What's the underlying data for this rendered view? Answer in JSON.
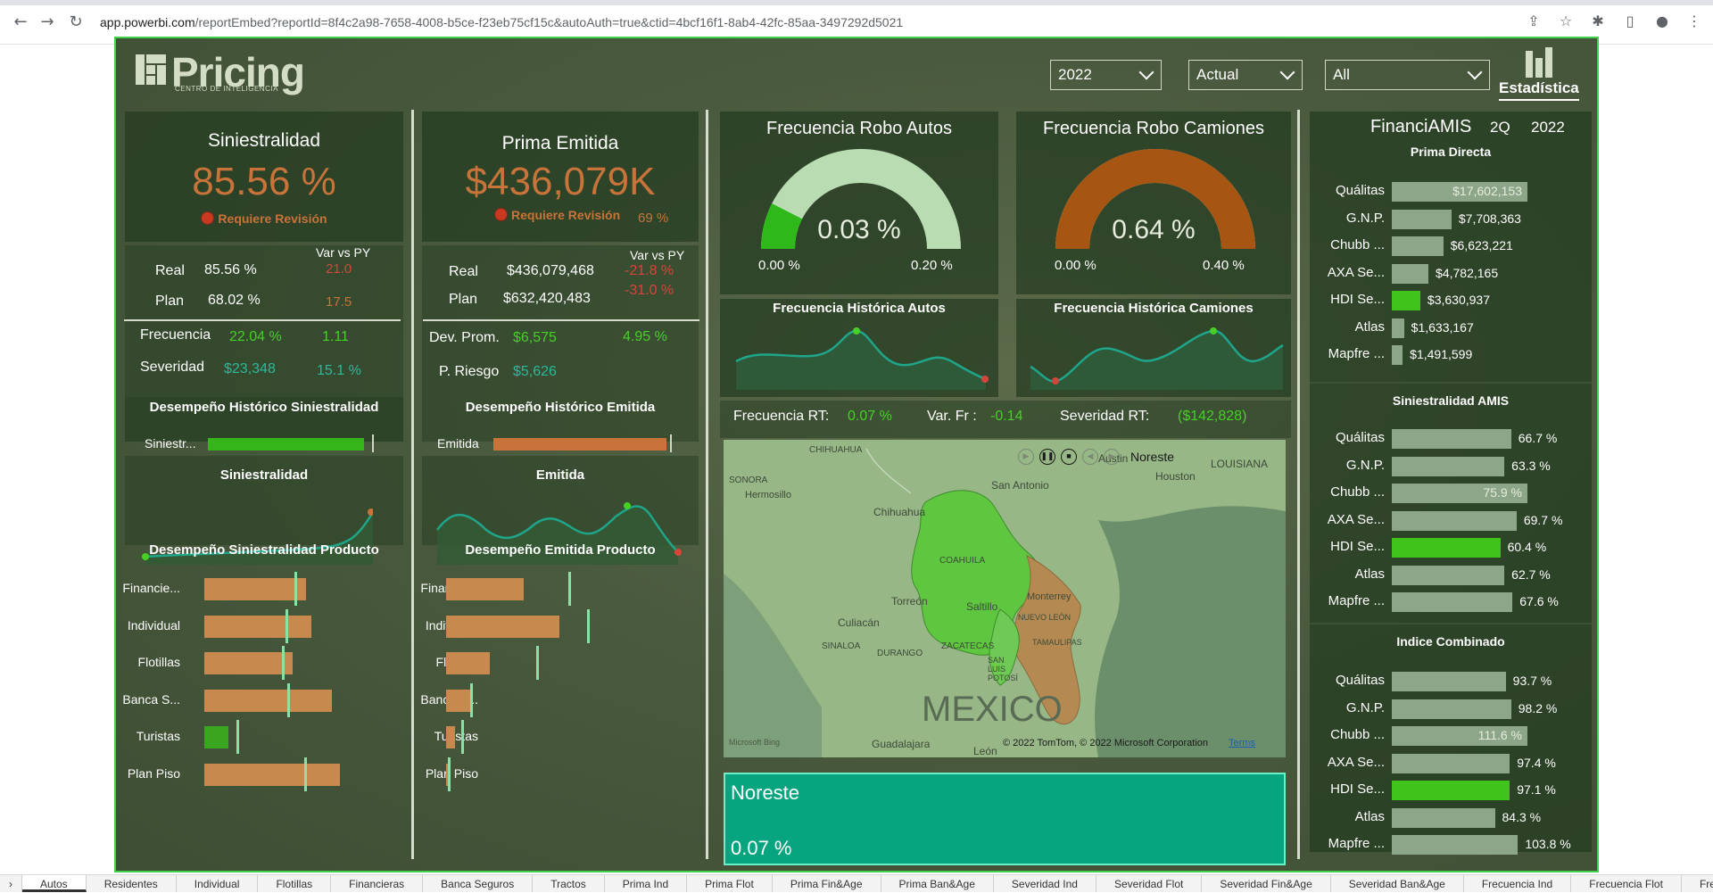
{
  "browser": {
    "url_host": "app.powerbi.com",
    "url_rest": "/reportEmbed?reportId=8f4c2a98-7658-4008-b5ce-f23eb75cf15c&autoAuth=true&ctid=4bcf16f1-8ab4-42fc-85aa-3497292d5021"
  },
  "header": {
    "logo_title": "Pricing",
    "logo_subtitle": "CENTRO DE INTELIGENCIA",
    "slicers": [
      "2022",
      "Actual",
      "All"
    ],
    "brand_label": "Estadística"
  },
  "siniestralidad": {
    "title": "Siniestralidad",
    "value": "85.56 %",
    "status": "Requiere Revisión",
    "var_header": "Var vs PY",
    "real_label": "Real",
    "real_value": "85.56 %",
    "real_var": "21.0",
    "plan_label": "Plan",
    "plan_value": "68.02 %",
    "plan_var": "17.5",
    "frecuencia_label": "Frecuencia",
    "frecuencia_value": "22.04 %",
    "frecuencia_var": "1.11",
    "severidad_label": "Severidad",
    "severidad_value": "$23,348",
    "severidad_var": "15.1 %",
    "desempeno_title": "Desempeño Histórico Siniestralidad",
    "desempeno_label": "Siniestr...",
    "desempeno_fill": 0.94,
    "line_title": "Siniestralidad",
    "producto_title": "Desempeño Siniestralidad Producto"
  },
  "prima": {
    "title": "Prima Emitida",
    "value": "$436,079K",
    "status": "Requiere Revisión",
    "status_pct": "69 %",
    "var_header": "Var vs PY",
    "real_label": "Real",
    "real_value": "$436,079,468",
    "real_var": "-21.8 %",
    "plan_label": "Plan",
    "plan_value": "$632,420,483",
    "plan_var": "-31.0 %",
    "devprom_label": "Dev. Prom.",
    "devprom_value": "$6,575",
    "devprom_var": "4.95 %",
    "priesgo_label": "P. Riesgo",
    "priesgo_value": "$5,626",
    "desempeno_title": "Desempeño Histórico Emitida",
    "desempeno_label": "Emitida",
    "desempeno_fill": 0.97,
    "line_title": "Emitida",
    "producto_title": "Desempeño Emitida Producto"
  },
  "productos": [
    {
      "label": "Financie...",
      "sin": 0.6,
      "sin_target": 0.53,
      "emi": 0.46,
      "emi_target": 0.72
    },
    {
      "label": "Individual",
      "sin": 0.63,
      "sin_target": 0.48,
      "emi": 0.67,
      "emi_target": 0.83
    },
    {
      "label": "Flotillas",
      "sin": 0.52,
      "sin_target": 0.46,
      "emi": 0.26,
      "emi_target": 0.53
    },
    {
      "label": "Banca S...",
      "sin": 0.75,
      "sin_target": 0.49,
      "emi": 0.14,
      "emi_target": 0.14
    },
    {
      "label": "Turistas",
      "sin": 0.14,
      "sin_target": 0.19,
      "emi": 0.05,
      "emi_target": 0.09
    },
    {
      "label": "Plan Piso",
      "sin": 0.8,
      "sin_target": 0.59,
      "emi": 0.02,
      "emi_target": 0.01
    }
  ],
  "robo_autos": {
    "title": "Frecuencia Robo Autos",
    "value": "0.03 %",
    "min": "0.00 %",
    "max": "0.20 %",
    "fill": 0.15,
    "hist_title": "Frecuencia Histórica Autos"
  },
  "robo_camiones": {
    "title": "Frecuencia Robo Camiones",
    "value": "0.64 %",
    "min": "0.00 %",
    "max": "0.40 %",
    "fill": 1.0,
    "hist_title": "Frecuencia Histórica Camiones"
  },
  "kpi_strip": {
    "frec_label": "Frecuencia RT:",
    "frec_value": "0.07 %",
    "var_label": "Var. Fr :",
    "var_value": "-0.14",
    "sev_label": "Severidad RT:",
    "sev_value": "($142,828)"
  },
  "map": {
    "region_label": "Noreste",
    "attribution": "© 2022 TomTom, © 2022 Microsoft Corporation",
    "terms": "Terms",
    "bing": "Microsoft Bing",
    "country": "MEXICO",
    "places": [
      "CHIHUAHUA",
      "SONORA",
      "Hermosillo",
      "Chihuahua",
      "San Antonio",
      "Houston",
      "LOUISIANA",
      "COAHUILA",
      "Torreón",
      "Saltillo",
      "Monterrey",
      "NUEVO LEÓN",
      "TAMAULIPAS",
      "Culiacán",
      "SINALOA",
      "DURANGO",
      "ZACATECAS",
      "SAN LUIS POTOSÍ",
      "Guadalajara",
      "León",
      "Austin"
    ]
  },
  "card": {
    "title": "Noreste",
    "value": "0.07 %"
  },
  "amis": {
    "title": "FinanciAMIS",
    "quarter": "2Q",
    "year": "2022",
    "prima_title": "Prima Directa",
    "prima": [
      {
        "label": "Quálitas",
        "value": "$17,602,153",
        "fill": 1.0,
        "hl": false,
        "inside": true
      },
      {
        "label": "G.N.P.",
        "value": "$7,708,363",
        "fill": 0.44,
        "hl": false,
        "inside": false
      },
      {
        "label": "Chubb ...",
        "value": "$6,623,221",
        "fill": 0.38,
        "hl": false,
        "inside": false
      },
      {
        "label": "AXA Se...",
        "value": "$4,782,165",
        "fill": 0.27,
        "hl": false,
        "inside": false
      },
      {
        "label": "HDI Se...",
        "value": "$3,630,937",
        "fill": 0.21,
        "hl": true,
        "inside": false
      },
      {
        "label": "Atlas",
        "value": "$1,633,167",
        "fill": 0.09,
        "hl": false,
        "inside": false
      },
      {
        "label": "Mapfre ...",
        "value": "$1,491,599",
        "fill": 0.08,
        "hl": false,
        "inside": false
      }
    ],
    "sin_title": "Siniestralidad AMIS",
    "sin": [
      {
        "label": "Quálitas",
        "value": "66.7 %",
        "fill": 0.88,
        "hl": false,
        "inside": false
      },
      {
        "label": "G.N.P.",
        "value": "63.3 %",
        "fill": 0.83,
        "hl": false,
        "inside": false
      },
      {
        "label": "Chubb ...",
        "value": "75.9 %",
        "fill": 1.0,
        "hl": false,
        "inside": true
      },
      {
        "label": "AXA Se...",
        "value": "69.7 %",
        "fill": 0.92,
        "hl": false,
        "inside": false
      },
      {
        "label": "HDI Se...",
        "value": "60.4 %",
        "fill": 0.8,
        "hl": true,
        "inside": false
      },
      {
        "label": "Atlas",
        "value": "62.7 %",
        "fill": 0.83,
        "hl": false,
        "inside": false
      },
      {
        "label": "Mapfre ...",
        "value": "67.6 %",
        "fill": 0.89,
        "hl": false,
        "inside": false
      }
    ],
    "ic_title": "Indice Combinado",
    "ic": [
      {
        "label": "Quálitas",
        "value": "93.7 %",
        "fill": 0.84,
        "hl": false,
        "inside": false
      },
      {
        "label": "G.N.P.",
        "value": "98.2 %",
        "fill": 0.88,
        "hl": false,
        "inside": false
      },
      {
        "label": "Chubb ...",
        "value": "111.6 %",
        "fill": 1.0,
        "hl": false,
        "inside": true
      },
      {
        "label": "AXA Se...",
        "value": "97.4 %",
        "fill": 0.87,
        "hl": false,
        "inside": false
      },
      {
        "label": "HDI Se...",
        "value": "97.1 %",
        "fill": 0.87,
        "hl": true,
        "inside": false
      },
      {
        "label": "Atlas",
        "value": "84.3 %",
        "fill": 0.76,
        "hl": false,
        "inside": false
      },
      {
        "label": "Mapfre ...",
        "value": "103.8 %",
        "fill": 0.93,
        "hl": false,
        "inside": false
      }
    ]
  },
  "tabs": [
    "Autos",
    "Residentes",
    "Individual",
    "Flotillas",
    "Financieras",
    "Banca Seguros",
    "Tractos",
    "Prima Ind",
    "Prima Flot",
    "Prima Fin&Age",
    "Prima Ban&Age",
    "Severidad Ind",
    "Severidad Flot",
    "Severidad Fin&Age",
    "Severidad Ban&Age",
    "Frecuencia Ind",
    "Frecuencia Flot",
    "Frecu"
  ],
  "colors": {
    "bg": "#485a3c",
    "orange": "#c8733a",
    "green": "#46d026",
    "bar_gray": "#8da68a",
    "teal": "#06a57f"
  }
}
